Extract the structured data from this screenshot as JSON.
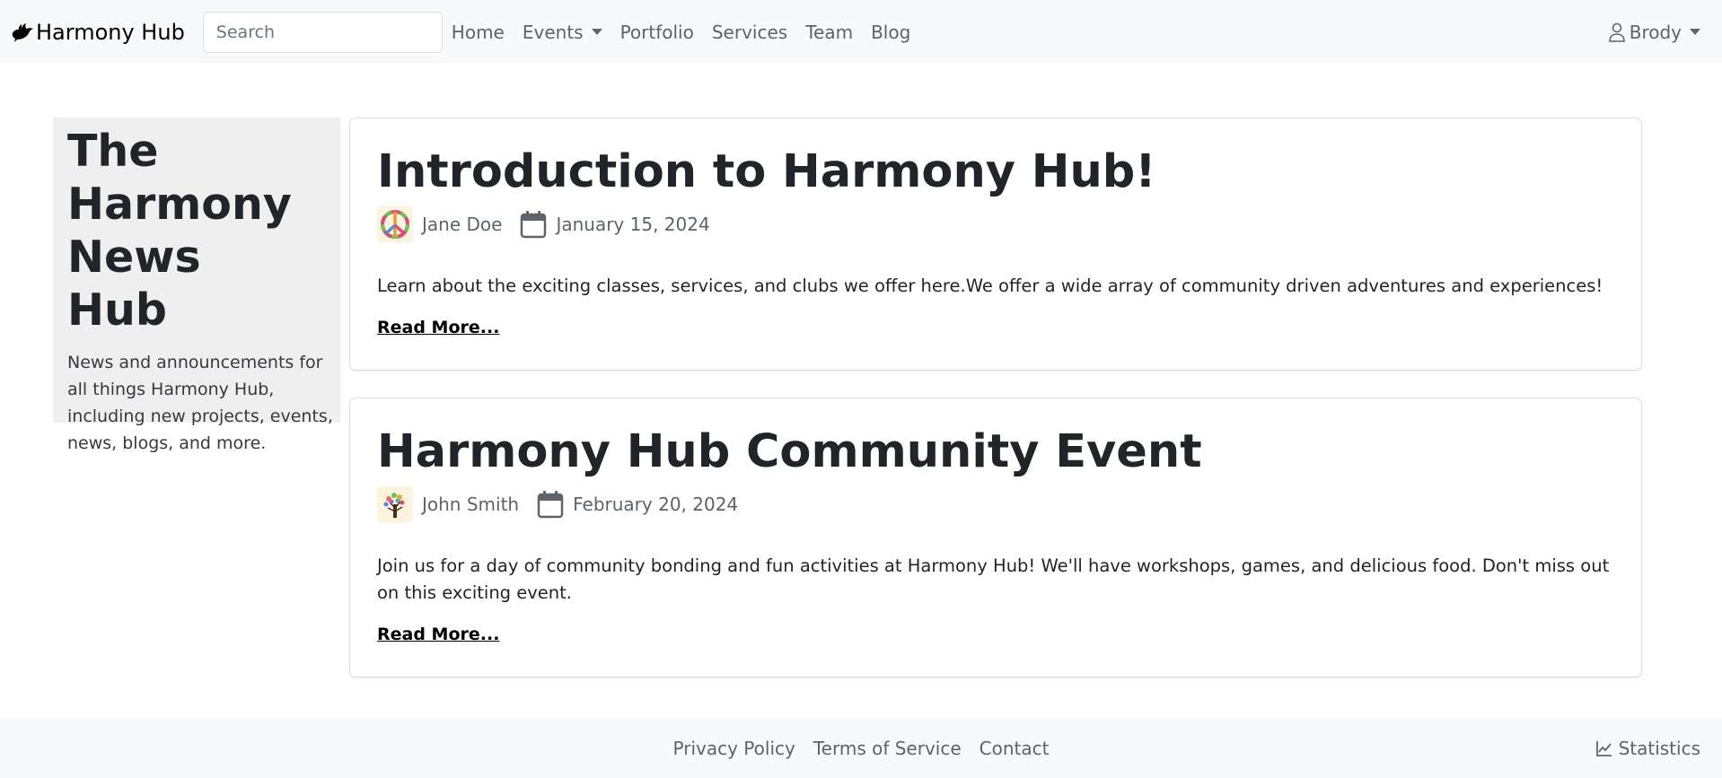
{
  "navbar": {
    "brand_name": "Harmony Hub",
    "brand_icon": "dove-icon",
    "search_placeholder": "Search",
    "search_value": "",
    "links": [
      {
        "label": "Home"
      },
      {
        "label": "Events",
        "dropdown": true
      },
      {
        "label": "Portfolio"
      },
      {
        "label": "Services"
      },
      {
        "label": "Team"
      },
      {
        "label": "Blog"
      }
    ],
    "user": {
      "name": "Brody",
      "icon": "person-icon"
    }
  },
  "sidebar": {
    "title": "The Harmony News Hub",
    "description": "News and announcements for all things Harmony Hub, including new projects, events, news, blogs, and more.",
    "background": "#efefef"
  },
  "posts": [
    {
      "title": "Introduction to Harmony Hub!",
      "author": "Jane Doe",
      "author_avatar": "peace-sign-avatar",
      "date": "January 15, 2024",
      "excerpt": "Learn about the exciting classes, services, and clubs we offer here.We offer a wide array of community driven adventures and experiences!",
      "read_more": "Read More..."
    },
    {
      "title": "Harmony Hub Community Event",
      "author": "John Smith",
      "author_avatar": "tree-avatar",
      "date": "February 20, 2024",
      "excerpt": "Join us for a day of community bonding and fun activities at Harmony Hub! We'll have workshops, games, and delicious food. Don't miss out on this exciting event.",
      "read_more": "Read More..."
    }
  ],
  "footer": {
    "links": [
      {
        "label": "Privacy Policy"
      },
      {
        "label": "Terms of Service"
      },
      {
        "label": "Contact"
      }
    ],
    "statistics_label": "Statistics",
    "statistics_icon": "line-chart-icon"
  },
  "colors": {
    "navbar_bg": "#f8f9fa",
    "text_muted": "#5c636a",
    "text_dark": "#212529"
  }
}
